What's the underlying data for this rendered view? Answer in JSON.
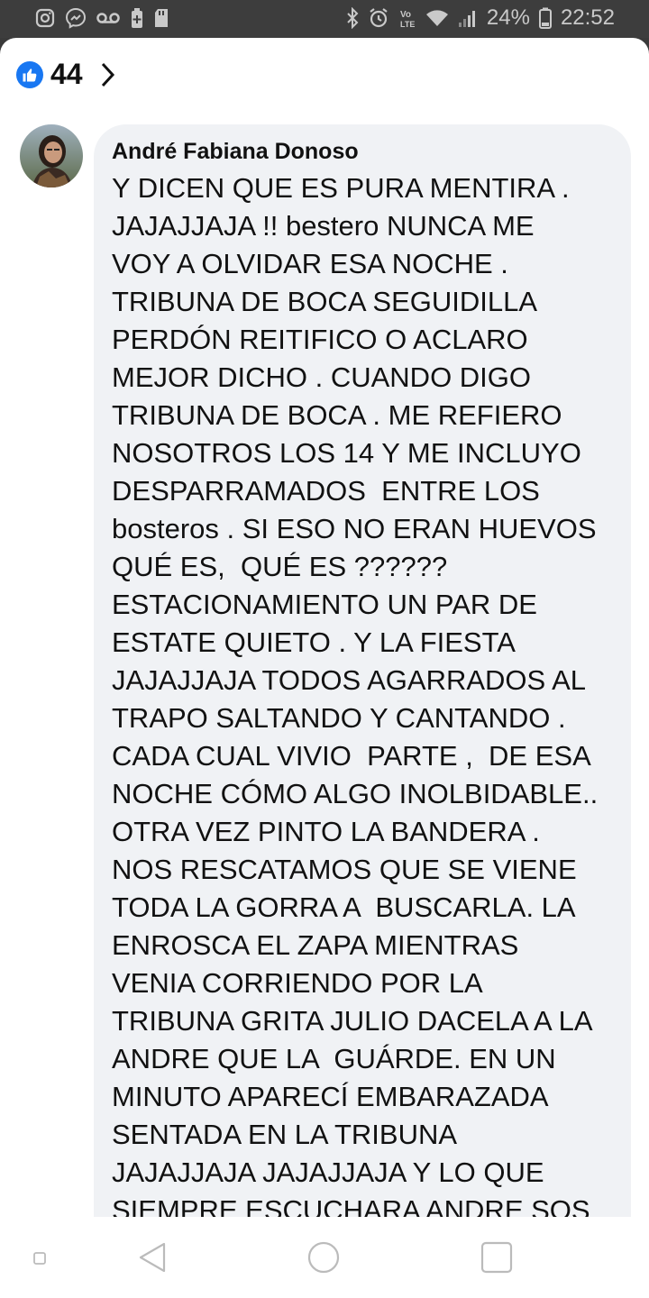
{
  "status_bar": {
    "battery_percent": "24%",
    "time": "22:52",
    "left_icons": [
      "instagram-icon",
      "messenger-icon",
      "voicemail-icon",
      "battery-saver-icon",
      "sd-card-icon"
    ],
    "right_icons": [
      "bluetooth-icon",
      "alarm-icon",
      "volte-icon",
      "wifi-icon",
      "signal-icon",
      "battery-icon"
    ]
  },
  "reactions": {
    "like_count": "44"
  },
  "comment": {
    "author": "André Fabiana Donoso",
    "text": "Y DICEN QUE ES PURA MENTIRA .\nJAJAJJAJA !! bestero NUNCA ME\nVOY A OLVIDAR ESA NOCHE .\nTRIBUNA DE BOCA SEGUIDILLA\nPERDÓN REITIFICO O ACLARO\nMEJOR DICHO . CUANDO DIGO\nTRIBUNA DE BOCA . ME REFIERO\nNOSOTROS LOS 14 Y ME INCLUYO\nDESPARRAMADOS  ENTRE LOS\nbosteros . SI ESO NO ERAN HUEVOS\nQUÉ ES,  QUÉ ES ??????\nESTACIONAMIENTO UN PAR DE\nESTATE QUIETO . Y LA FIESTA\nJAJAJJAJA TODOS AGARRADOS AL\nTRAPO SALTANDO Y CANTANDO .\nCADA CUAL VIVIO  PARTE ,  DE ESA\nNOCHE CÓMO ALGO INOLBIDABLE..\nOTRA VEZ PINTO LA BANDERA .\nNOS RESCATAMOS QUE SE VIENE\nTODA LA GORRA A  BUSCARLA. LA\nENROSCA EL ZAPA MIENTRAS\nVENIA CORRIENDO POR LA\nTRIBUNA GRITA JULIO DACELA A LA\nANDRE QUE LA  GUÁRDE. EN UN\nMINUTO APARECÍ EMBARAZADA\nSENTADA EN LA TRIBUNA\nJAJAJJAJA JAJAJJAJA Y LO QUE\nSIEMPRE ESCUCHARA ANDRE SOS"
  },
  "colors": {
    "like_blue": "#1877f2",
    "bubble_bg": "#f0f2f5",
    "status_bar_bg": "#3d3d3d"
  },
  "nav": [
    "recents-dot-icon",
    "back-icon",
    "home-icon",
    "overview-icon"
  ]
}
